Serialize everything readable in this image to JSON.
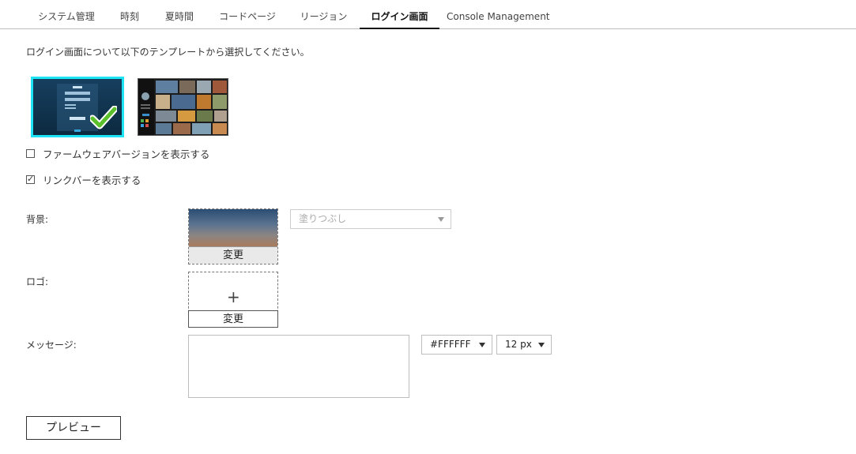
{
  "tabs": [
    {
      "label": "システム管理",
      "active": false
    },
    {
      "label": "時刻",
      "active": false
    },
    {
      "label": "夏時間",
      "active": false
    },
    {
      "label": "コードページ",
      "active": false
    },
    {
      "label": "リージョン",
      "active": false
    },
    {
      "label": "ログイン画面",
      "active": true
    },
    {
      "label": "Console Management",
      "active": false
    }
  ],
  "intro_text": "ログイン画面について以下のテンプレートから選択してください。",
  "templates": [
    {
      "selected": true
    },
    {
      "selected": false
    }
  ],
  "options": {
    "show_firmware": {
      "label": "ファームウェアバージョンを表示する",
      "checked": false
    },
    "show_linkbar": {
      "label": "リンクバーを表示する",
      "checked": true
    }
  },
  "background": {
    "label": "背景:",
    "change_label": "変更",
    "fill_mode": "塗りつぶし"
  },
  "logo": {
    "label": "ロゴ:",
    "change_label": "変更",
    "add_glyph": "+"
  },
  "message": {
    "label": "メッセージ:",
    "value": "",
    "color": "#FFFFFF",
    "font_size": "12 px"
  },
  "preview_label": "プレビュー",
  "colors": {
    "accent_selected": "#1ee3f5",
    "check_green": "#5cc02c"
  }
}
